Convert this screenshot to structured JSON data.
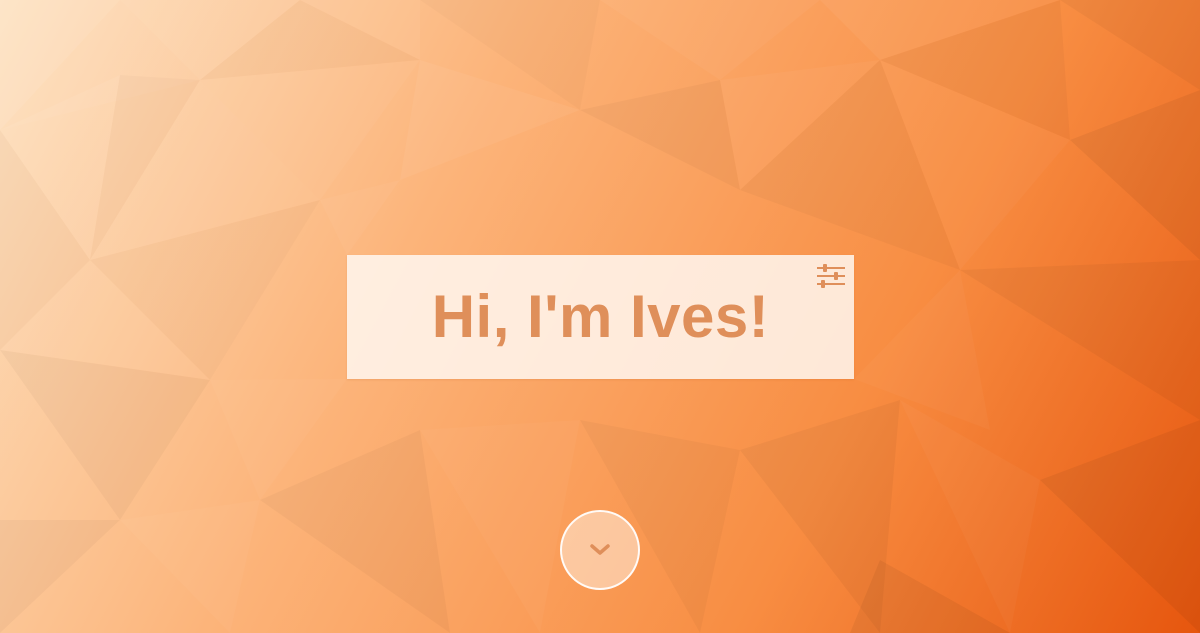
{
  "hero": {
    "title": "Hi, I'm Ives!",
    "settings_icon": "sliders-icon"
  },
  "scroll_down": {
    "icon": "chevron-down-icon"
  },
  "colors": {
    "title_text": "#df8f5a",
    "card_background": "#fff7f0",
    "icon": "#df8f5a",
    "background_light": "#fde3c4",
    "background_mid": "#fb9a50",
    "background_dark": "#e6560e"
  }
}
